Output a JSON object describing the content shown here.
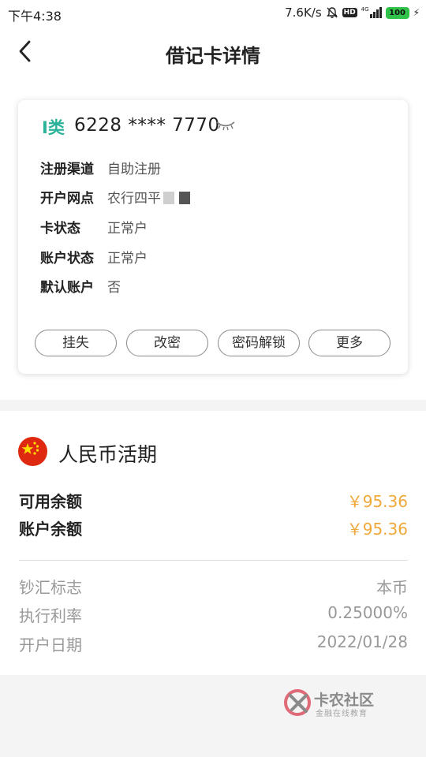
{
  "status_bar": {
    "time": "下午4:38",
    "net_speed": "7.6K/s",
    "hd_badge": "HD",
    "network": "4G",
    "battery": "100"
  },
  "header": {
    "title": "借记卡详情"
  },
  "card": {
    "type_label": "I类",
    "number": "6228 **** 7770",
    "rows": [
      {
        "label": "注册渠道",
        "value": "自助注册"
      },
      {
        "label": "开户网点",
        "value": "农行四平"
      },
      {
        "label": "卡状态",
        "value": "正常户"
      },
      {
        "label": "账户状态",
        "value": "正常户"
      },
      {
        "label": "默认账户",
        "value": "否"
      }
    ],
    "actions": [
      "挂失",
      "改密",
      "密码解锁",
      "更多"
    ]
  },
  "account": {
    "currency_title": "人民币活期",
    "available_label": "可用余额",
    "available_value": "￥95.36",
    "balance_label": "账户余额",
    "balance_value": "￥95.36",
    "details": [
      {
        "label": "钞汇标志",
        "value": "本币"
      },
      {
        "label": "执行利率",
        "value": "0.25000%"
      },
      {
        "label": "开户日期",
        "value": "2022/01/28"
      }
    ]
  },
  "watermark": {
    "title": "卡农社区",
    "subtitle": "金融在线教育"
  },
  "colors": {
    "accent_type": "#2bb39a",
    "amount": "#f0a839",
    "flag_red": "#de2910",
    "flag_star": "#ffde00"
  }
}
